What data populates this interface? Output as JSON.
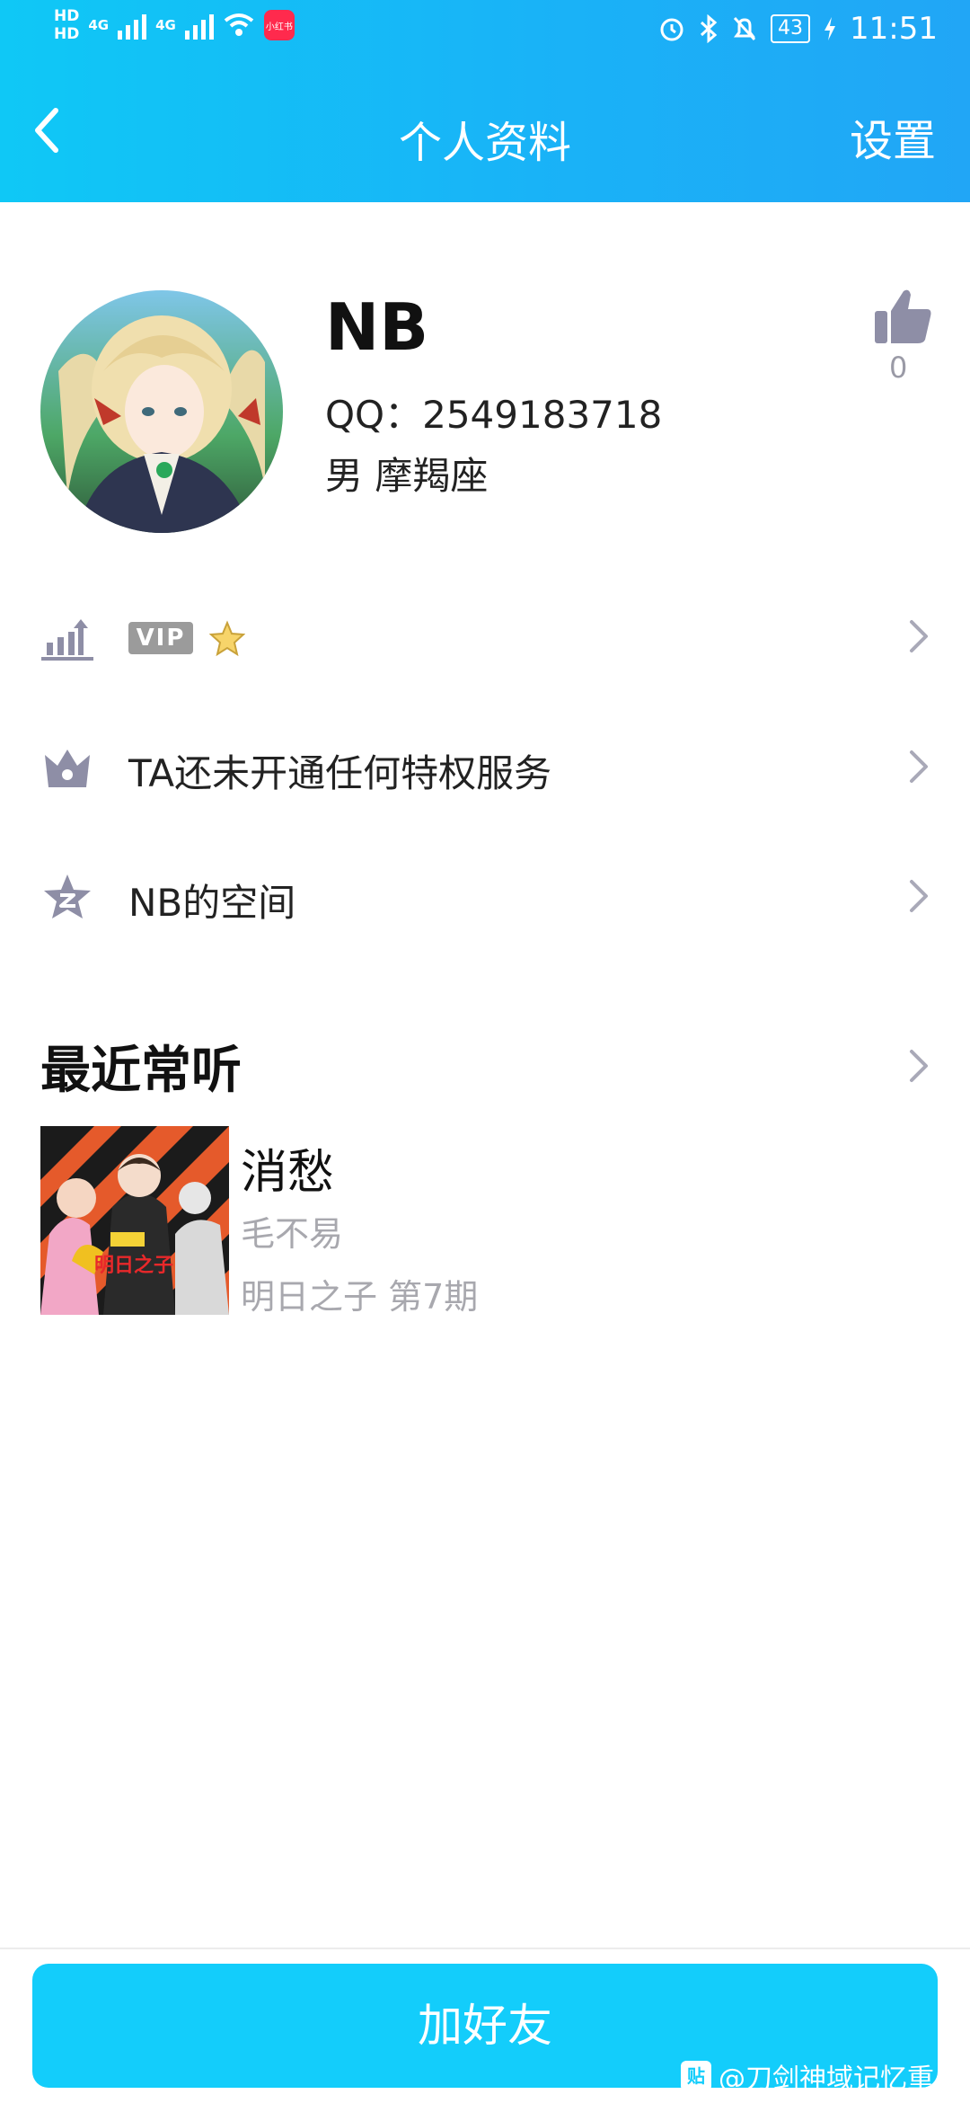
{
  "status_bar": {
    "hd1": "HD",
    "hd2": "HD",
    "net1": "4G",
    "net2": "4G",
    "app_badge": "小红书",
    "battery": "43",
    "time": "11:51"
  },
  "nav": {
    "title": "个人资料",
    "settings": "设置"
  },
  "profile": {
    "name": "NB",
    "qq": "QQ：2549183718",
    "gender_sign": "男  摩羯座",
    "like_count": "0"
  },
  "rows": {
    "vip_badge": "VIP",
    "privilege": "TA还未开通任何特权服务",
    "space": "NB的空间"
  },
  "music": {
    "section_title": "最近常听",
    "song": "消愁",
    "artist": "毛不易",
    "album": "明日之子 第7期"
  },
  "footer": {
    "add_friend": "加好友",
    "watermark_icon": "贴",
    "watermark": "@刀剑神域记忆重…"
  },
  "colors": {
    "header_start": "#0fc8f6",
    "header_end": "#21a6f6",
    "button": "#13cdfb",
    "icon_gray": "#8e8ea6"
  }
}
